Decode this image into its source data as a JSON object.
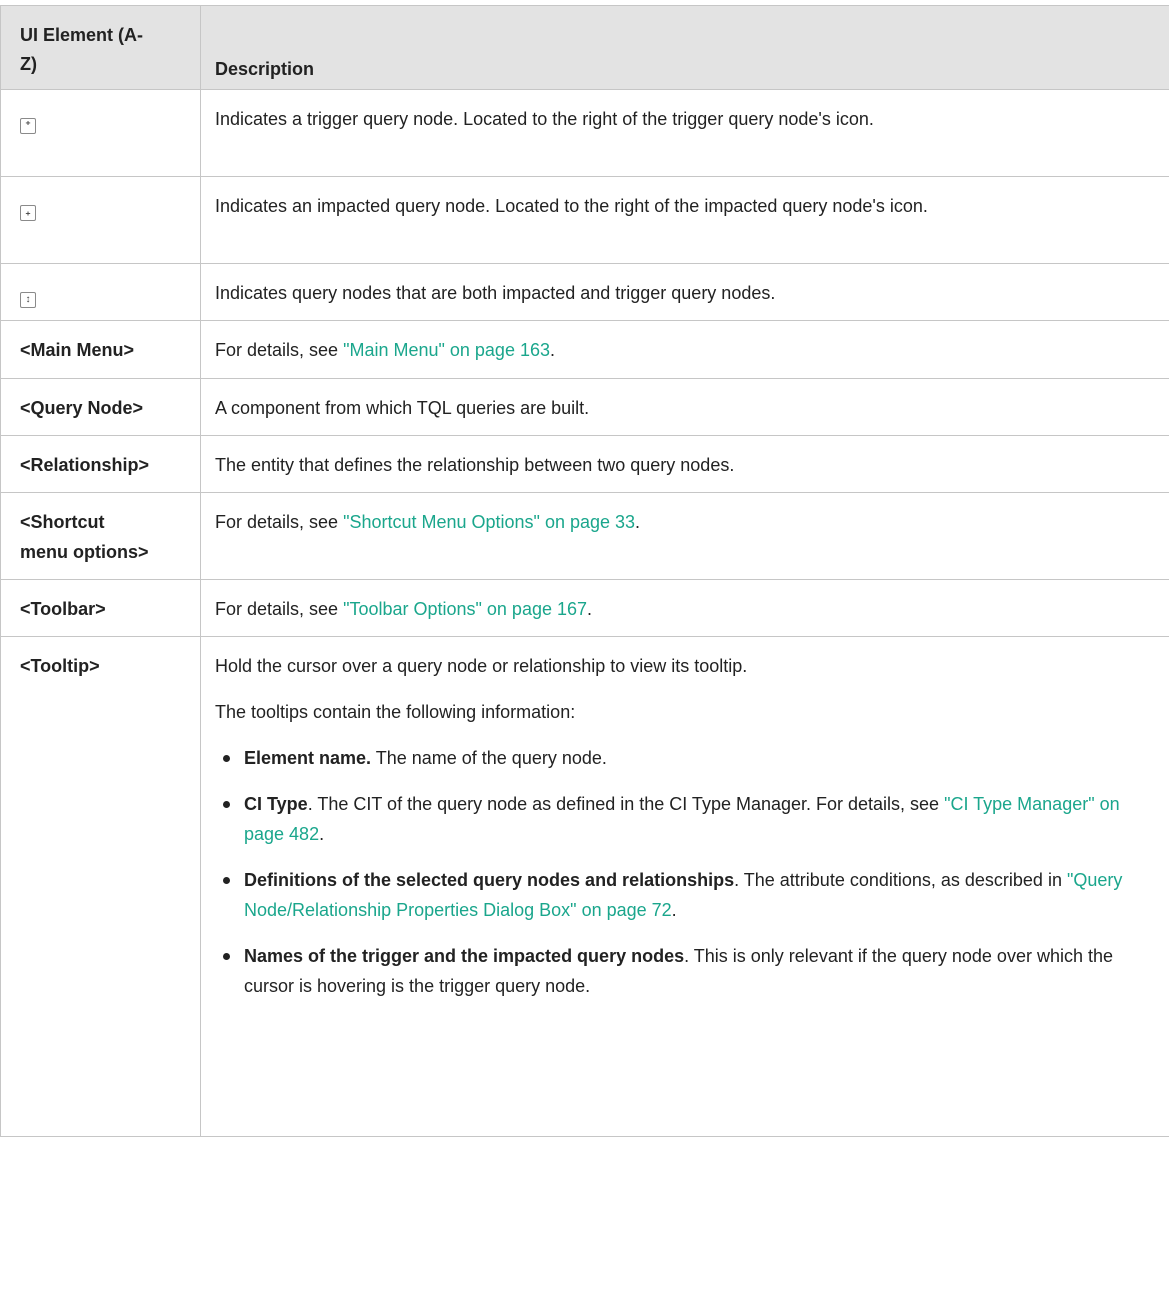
{
  "header": {
    "col1": "UI Element (A-Z)",
    "col1_line1": "UI Element (A-",
    "col1_line2": "Z)",
    "col2": "Description"
  },
  "rows": [
    {
      "icon": "trigger-query-node-icon",
      "glyph": "⁺",
      "desc": "Indicates a trigger query node. Located to the right of the trigger query node's icon."
    },
    {
      "icon": "impacted-query-node-icon",
      "glyph": "₊",
      "desc": "Indicates an impacted query node. Located to the right of the impacted query node's icon."
    },
    {
      "icon": "both-query-node-icon",
      "glyph": "↕",
      "desc": "Indicates query nodes that are both impacted and trigger query nodes."
    }
  ],
  "main_menu": {
    "element": "<Main Menu>",
    "pre": "For details, see ",
    "link": "\"Main Menu\" on page 163",
    "post": "."
  },
  "query_node": {
    "element": "<Query Node>",
    "desc": "A component from which TQL queries are built."
  },
  "relationship": {
    "element": "<Relationship>",
    "desc": "The entity that defines the relationship between two query nodes."
  },
  "shortcut": {
    "element_line1": "<Shortcut",
    "element_line2": "menu options>",
    "pre": "For details, see ",
    "link": "\"Shortcut Menu Options\" on page 33",
    "post": "."
  },
  "toolbar": {
    "element": "<Toolbar>",
    "pre": "For details, see ",
    "link": "\"Toolbar Options\" on page 167",
    "post": "."
  },
  "tooltip": {
    "element": "<Tooltip>",
    "p1": "Hold the cursor over a query node or relationship to view its tooltip.",
    "p2": "The tooltips contain the following information:",
    "b1_bold": "Element name.",
    "b1_text": " The name of the query node.",
    "b2_bold": "CI Type",
    "b2_text": ". The CIT of the query node as defined in the CI Type Manager. For details, see ",
    "b2_link": "\"CI Type Manager\" on page 482",
    "b2_post": ".",
    "b3_bold": "Definitions of the selected query nodes and relationships",
    "b3_text": ". The attribute conditions, as described in ",
    "b3_link": "\"Query Node/Relationship Properties Dialog Box\" on page 72",
    "b3_post": ".",
    "b4_bold": "Names of the trigger and the impacted query nodes",
    "b4_text": ". This is only relevant if the query node over which the cursor is hovering is the trigger query node."
  }
}
